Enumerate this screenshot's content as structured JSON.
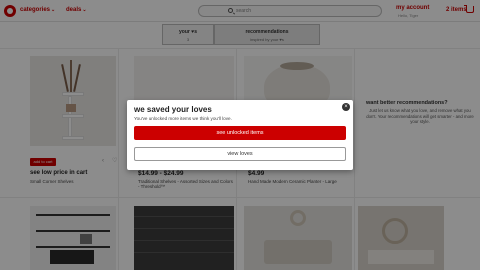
{
  "header": {
    "categories_label": "categories",
    "deals_label": "deals",
    "search_placeholder": "search",
    "account_label": "my account",
    "account_sub": "Hello, Tiger",
    "cart_label": "2 items"
  },
  "tabs": [
    {
      "label": "your ♥s",
      "sub": "3"
    },
    {
      "label": "recommendations",
      "sub": "inspired by your ♥s"
    }
  ],
  "products": [
    {
      "button": "add to cart",
      "promo": "see low price in cart",
      "name": "Small Corner Shelves"
    },
    {
      "price": "$14.99 - $24.99",
      "name": "Traditional Shelves - Assorted Sizes and Colors - Threshold™"
    },
    {
      "price": "$4.99",
      "name": "Hand Made Modern Ceramic Planter - Large"
    }
  ],
  "recommendations_panel": {
    "title": "want better recommendations?",
    "text": "Just let us know what you love, and remove what you don't. Your recommendations will get smarter - and more your style."
  },
  "modal": {
    "title": "we saved your loves",
    "subtitle": "You've unlocked more items we think you'll love.",
    "primary_button": "see unlocked items",
    "secondary_button": "view loves",
    "close_icon": "×"
  },
  "colors": {
    "brand": "#cc0000",
    "overlay": "rgba(0,0,0,0.45)"
  }
}
